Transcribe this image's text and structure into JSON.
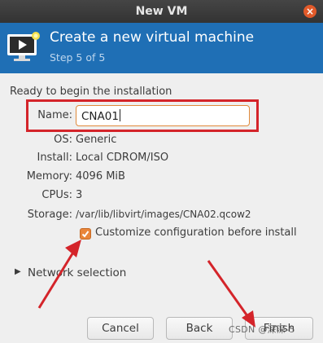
{
  "window": {
    "title": "New VM",
    "close_glyph": "×"
  },
  "banner": {
    "title": "Create a new virtual machine",
    "step": "Step 5 of 5",
    "icon": "vm-monitor-icon",
    "color": "#1f6fb5"
  },
  "form": {
    "heading": "Ready to begin the installation",
    "name_label": "Name:",
    "name_value": "CNA01",
    "os_label": "OS:",
    "os_value": "Generic",
    "install_label": "Install:",
    "install_value": "Local CDROM/ISO",
    "memory_label": "Memory:",
    "memory_value": "4096 MiB",
    "cpus_label": "CPUs:",
    "cpus_value": "3",
    "storage_label": "Storage:",
    "storage_value": "/var/lib/libvirt/images/CNA02.qcow2",
    "customize_label": "Customize configuration before install",
    "customize_checked": true
  },
  "network": {
    "expander_glyph": "▶",
    "label": "Network selection"
  },
  "buttons": {
    "cancel": "Cancel",
    "back": "Back",
    "finish": "Finish"
  },
  "watermark": "CSDN @深深-5",
  "annotation_color": "#d4242a"
}
